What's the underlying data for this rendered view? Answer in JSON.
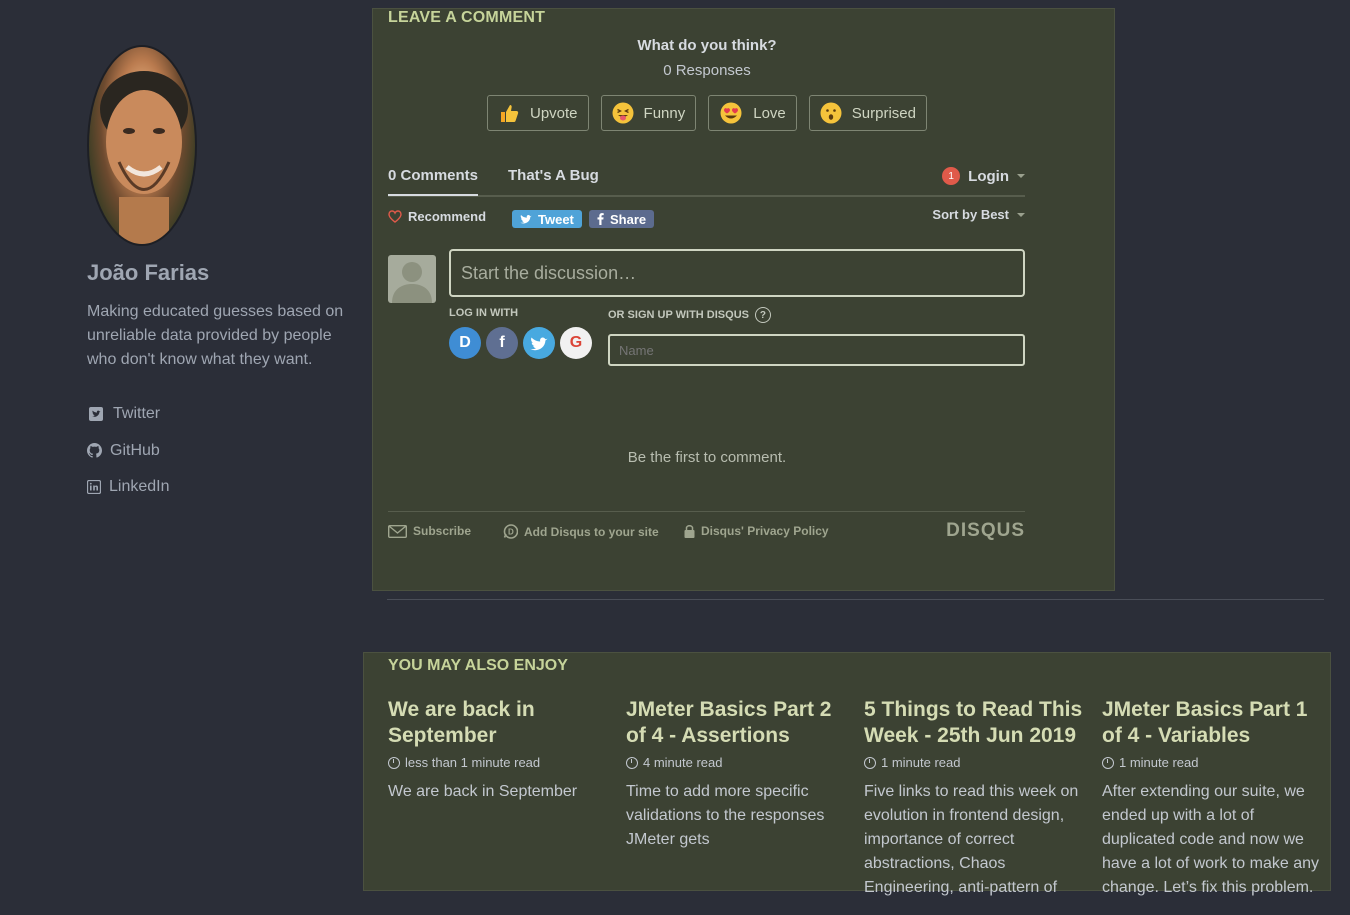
{
  "author": {
    "name": "João Farias",
    "bio": "Making educated guesses based on unreliable data provided by people who don't know what they want.",
    "links": [
      {
        "label": "Twitter",
        "icon": "twitter-icon"
      },
      {
        "label": "GitHub",
        "icon": "github-icon"
      },
      {
        "label": "LinkedIn",
        "icon": "linkedin-icon"
      }
    ]
  },
  "comments": {
    "section_title": "LEAVE A COMMENT",
    "prompt": "What do you think?",
    "responses": "0 Responses",
    "reactions": [
      {
        "label": "Upvote",
        "icon": "thumbs-up-icon"
      },
      {
        "label": "Funny",
        "icon": "tongue-face-icon"
      },
      {
        "label": "Love",
        "icon": "heart-eyes-icon"
      },
      {
        "label": "Surprised",
        "icon": "surprised-face-icon"
      }
    ],
    "tab_comments": "0 Comments",
    "tab_community": "That's A Bug",
    "notification_count": "1",
    "login": "Login",
    "recommend": "Recommend",
    "tweet": "Tweet",
    "share": "Share",
    "sort": "Sort by Best",
    "placeholder": "Start the discussion…",
    "log_in_with": "LOG IN WITH",
    "or_sign_up": "OR SIGN UP WITH DISQUS",
    "help": "?",
    "name_placeholder": "Name",
    "empty_state": "Be the first to comment.",
    "footer": {
      "subscribe": "Subscribe",
      "add_disqus": "Add Disqus to your site",
      "privacy": "Disqus' Privacy Policy",
      "logo": "DISQUS"
    }
  },
  "related": {
    "title": "YOU MAY ALSO ENJOY",
    "posts": [
      {
        "title": "We are back in September",
        "read_time": "less than 1 minute read",
        "excerpt": "We are back in September"
      },
      {
        "title": "JMeter Basics Part 2 of 4 - Assertions",
        "read_time": "4 minute read",
        "excerpt": "Time to add more specific validations to the responses JMeter gets"
      },
      {
        "title": "5 Things to Read This Week - 25th Jun 2019",
        "read_time": "1 minute read",
        "excerpt": "Five links to read this week on evolution in frontend design, importance of correct abstractions, Chaos Engineering, anti-pattern of"
      },
      {
        "title": "JMeter Basics Part 1 of 4 - Variables",
        "read_time": "1 minute read",
        "excerpt": "After extending our suite, we ended up with a lot of duplicated code and now we have a lot of work to make any change. Let’s fix this problem."
      }
    ]
  },
  "colors": {
    "page_bg": "#2b2e38",
    "panel_bg": "#3c4233",
    "accent": "#c6d49a"
  }
}
